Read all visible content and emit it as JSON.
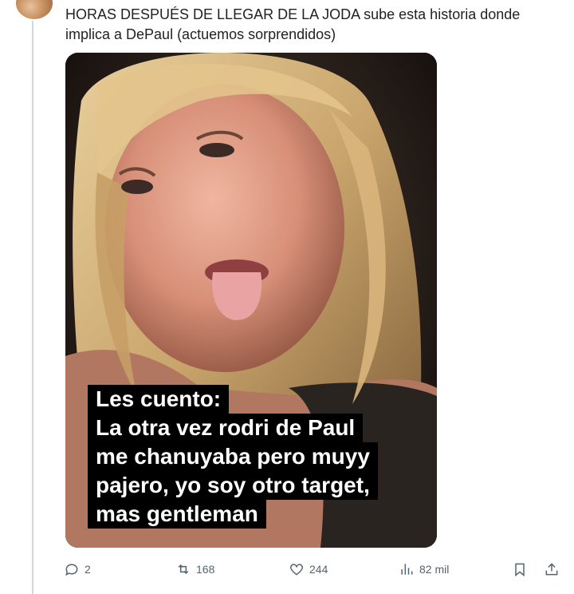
{
  "post": {
    "text_bold": "HORAS DESPUÉS DE LLEGAR DE LA JODA",
    "text_rest": " sube esta historia donde implica a DePaul (actuemos sorprendidos)"
  },
  "media": {
    "caption_lines": [
      "Les cuento:",
      "La otra vez rodri de Paul",
      "me chanuyaba pero muyy",
      "pajero, yo soy otro target,",
      "mas  gentleman"
    ]
  },
  "actions": {
    "replies": "2",
    "reposts": "168",
    "likes": "244",
    "views": "82 mil"
  },
  "icons": [
    "reply-icon",
    "repost-icon",
    "like-icon",
    "views-icon",
    "bookmark-icon",
    "share-icon"
  ],
  "colors": {
    "icon_gray": "#536471",
    "thread_line": "#cfd9de"
  }
}
